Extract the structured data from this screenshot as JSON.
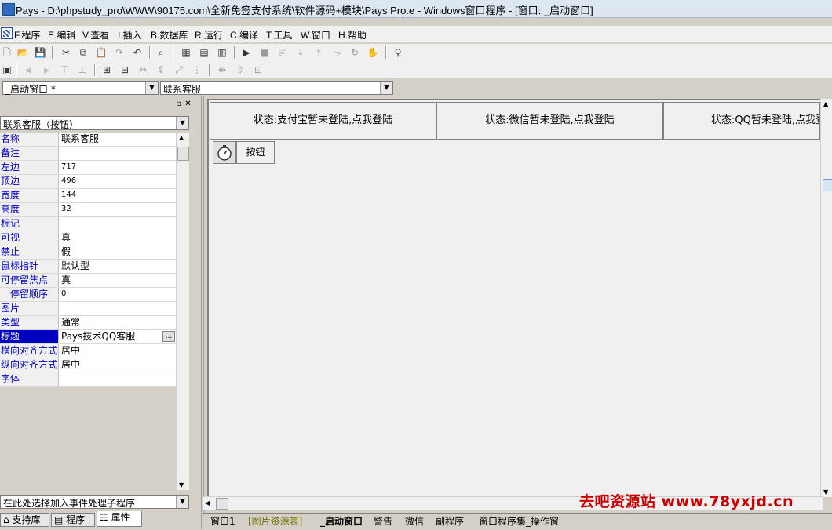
{
  "window": {
    "title": "Pays - D:\\phpstudy_pro\\WWW\\90175.com\\全新免签支付系统\\软件源码+模块\\Pays Pro.e - Windows窗口程序 - [窗口: _启动窗口]"
  },
  "menu": [
    {
      "label": "F.程序"
    },
    {
      "label": "E.编辑"
    },
    {
      "label": "V.查看"
    },
    {
      "label": "I.插入"
    },
    {
      "label": "B.数据库"
    },
    {
      "label": "R.运行"
    },
    {
      "label": "C.编译"
    },
    {
      "label": "T.工具"
    },
    {
      "label": "W.窗口"
    },
    {
      "label": "H.帮助"
    }
  ],
  "toolbar": {
    "row1": [
      "new-icon",
      "open-icon",
      "save-icon",
      "cut-icon",
      "copy-icon",
      "paste-icon",
      "redo-icon",
      "undo-icon",
      "find-icon",
      "layout1-icon",
      "layout2-icon",
      "layout3-icon",
      "run-icon",
      "stop-icon",
      "step1-icon",
      "step2-icon",
      "step3-icon",
      "step4-icon",
      "step5-icon",
      "hand-icon",
      "binoculars-icon"
    ],
    "row2": [
      "align-left-icon",
      "align-right-icon",
      "align-top-icon",
      "align-bottom-icon",
      "center-h-icon",
      "center-v-icon",
      "same-width-icon",
      "same-height-icon",
      "same-size-icon",
      "space-h-icon",
      "space-v-icon",
      "grid-icon"
    ]
  },
  "selectors": {
    "window_combo": "_启动窗口 *",
    "control_combo": "联系客服"
  },
  "left_panel": {
    "object_combo": "联系客服（按钮）",
    "properties": [
      {
        "name": "名称",
        "value": "联系客服"
      },
      {
        "name": "备注",
        "value": ""
      },
      {
        "name": "左边",
        "value": "717"
      },
      {
        "name": "顶边",
        "value": "496"
      },
      {
        "name": "宽度",
        "value": "144"
      },
      {
        "name": "高度",
        "value": "32"
      },
      {
        "name": "标记",
        "value": ""
      },
      {
        "name": "可视",
        "value": "真"
      },
      {
        "name": "禁止",
        "value": "假"
      },
      {
        "name": "鼠标指针",
        "value": "默认型"
      },
      {
        "name": "可停留焦点",
        "value": "真"
      },
      {
        "name": "停留顺序",
        "value": "0",
        "indent": true
      },
      {
        "name": "图片",
        "value": ""
      },
      {
        "name": "类型",
        "value": "通常"
      },
      {
        "name": "标题",
        "value": "Pays技术QQ客服",
        "selected": true,
        "has_button": true,
        "button_label": "..."
      },
      {
        "name": "横向对齐方式",
        "value": "居中"
      },
      {
        "name": "纵向对齐方式",
        "value": "居中"
      },
      {
        "name": "字体",
        "value": ""
      }
    ],
    "event_combo": "在此处选择加入事件处理子程序",
    "tabs": [
      {
        "label": "支持库"
      },
      {
        "label": "程序"
      },
      {
        "label": "属性",
        "active": true
      }
    ]
  },
  "designer": {
    "status_labels": [
      {
        "text": "状态:支付宝暂未登陆,点我登陆"
      },
      {
        "text": "状态:微信暂未登陆,点我登陆"
      },
      {
        "text": "状态:QQ暂未登陆,点我登陆"
      }
    ],
    "button_label": "按钮"
  },
  "watermark": "去吧资源站 www.78yxjd.cn",
  "project_tabs": [
    {
      "label": "窗口1"
    },
    {
      "label": "[图片资源表]"
    },
    {
      "label": "_启动窗口",
      "active": true
    },
    {
      "label": "警告"
    },
    {
      "label": "微信"
    },
    {
      "label": "副程序"
    },
    {
      "label": "窗口程序集_操作窗"
    }
  ]
}
